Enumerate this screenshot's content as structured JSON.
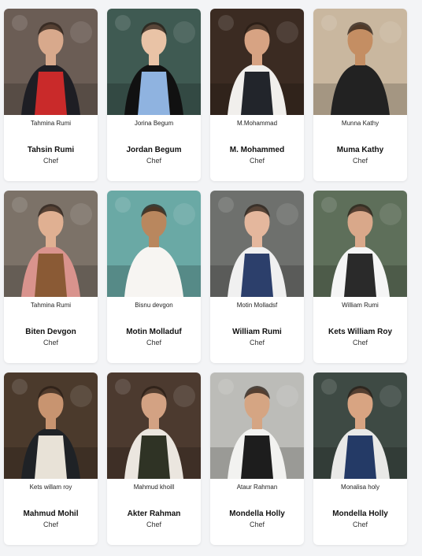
{
  "cards": [
    {
      "caption": "Tahmina Rumi",
      "name": "Tahsin Rumi",
      "role": "Chef",
      "photo": "chef-red-apron-photo",
      "colors": {
        "bg": "#6b5d55",
        "skin": "#d8a98c",
        "top": "#1e1e24",
        "apron": "#c92a2a"
      }
    },
    {
      "caption": "Jorina Begum",
      "name": "Jordan Begum",
      "role": "Chef",
      "photo": "chef-blue-apron-photo",
      "colors": {
        "bg": "#3f5a52",
        "skin": "#e9c3a6",
        "top": "#111111",
        "apron": "#8fb3e0"
      }
    },
    {
      "caption": "M.Mohammad",
      "name": "M. Mohammed",
      "role": "Chef",
      "photo": "chef-kitchen-lamps-photo",
      "colors": {
        "bg": "#3b2b22",
        "skin": "#d7a383",
        "top": "#f1efec",
        "apron": "#22252b"
      }
    },
    {
      "caption": "Munna Kathy",
      "name": "Muma Kathy",
      "role": "Chef",
      "photo": "chef-white-hat-photo",
      "colors": {
        "bg": "#c9b79f",
        "skin": "#c48e63",
        "top": "#222222",
        "apron": "#222222"
      }
    },
    {
      "caption": "Tahmina Rumi",
      "name": "Biten Devgon",
      "role": "Chef",
      "photo": "chef-brown-apron-photo",
      "colors": {
        "bg": "#7c7268",
        "skin": "#e0b092",
        "top": "#d9938d",
        "apron": "#8a5a35"
      }
    },
    {
      "caption": "Bisnu devgon",
      "name": "Motin Molladuf",
      "role": "Chef",
      "photo": "chef-outdoor-photo",
      "colors": {
        "bg": "#6aa9a5",
        "skin": "#b9875e",
        "top": "#f7f5f2",
        "apron": "#f7f5f2"
      }
    },
    {
      "caption": "Motin Molladsf",
      "name": "William Rumi",
      "role": "Chef",
      "photo": "chef-cutting-photo",
      "colors": {
        "bg": "#6e706d",
        "skin": "#e4b79d",
        "top": "#f0f0f0",
        "apron": "#2c3f6b"
      }
    },
    {
      "caption": "William Rumi",
      "name": "Kets William Roy",
      "role": "Chef",
      "photo": "chef-plating-photo",
      "colors": {
        "bg": "#5e6f5a",
        "skin": "#d9a88a",
        "top": "#f5f5f5",
        "apron": "#2a2a2a"
      }
    },
    {
      "caption": "Kets willam roy",
      "name": "Mahmud Mohil",
      "role": "Chef",
      "photo": "chefs-table-photo",
      "colors": {
        "bg": "#4b3a2c",
        "skin": "#c89470",
        "top": "#1f2226",
        "apron": "#e8e2d7"
      }
    },
    {
      "caption": "Mahmud khoill",
      "name": "Akter Rahman",
      "role": "Chef",
      "photo": "chef-pantry-photo",
      "colors": {
        "bg": "#4c3a2f",
        "skin": "#d3a283",
        "top": "#ebe6df",
        "apron": "#2f3325"
      }
    },
    {
      "caption": "Ataur Rahman",
      "name": "Mondella Holly",
      "role": "Chef",
      "photo": "chef-prepping-photo",
      "colors": {
        "bg": "#bcbcb8",
        "skin": "#d5a583",
        "top": "#f2f2f0",
        "apron": "#1d1d1d"
      }
    },
    {
      "caption": "Monalisa holy",
      "name": "Mondella Holly",
      "role": "Chef",
      "photo": "chef-striped-apron-photo",
      "colors": {
        "bg": "#3e4a44",
        "skin": "#d8a482",
        "top": "#e9e9e7",
        "apron": "#243a66"
      }
    }
  ]
}
